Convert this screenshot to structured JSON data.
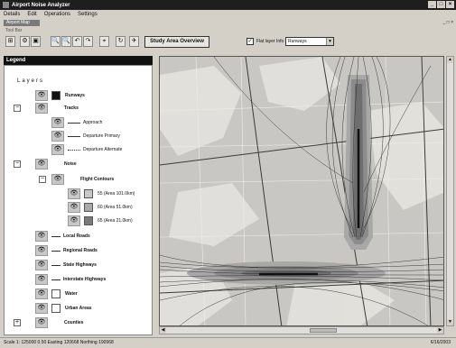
{
  "window": {
    "title": "Airport Noise Analyzer",
    "minimize": "_",
    "maximize": "□",
    "close": "×"
  },
  "menu": [
    "Details",
    "Edit",
    "Operations",
    "Settings"
  ],
  "doc_tab": {
    "label": "Airport Map",
    "controls": "_ □ ×"
  },
  "toolbar": {
    "caption": "Tool Bar",
    "buttons": [
      "⊞",
      "⚙",
      "▣",
      "🔍",
      "🔍",
      "↶",
      "↷",
      "⌖",
      "↻",
      "✈"
    ],
    "study_button": "Study Area Overview",
    "checkbox_checked": "✓",
    "checkbox_label": "Flat layer Info",
    "dropdown_value": "Runways",
    "dropdown_arrow": "▼"
  },
  "legend": {
    "header": "Legend",
    "layers_title": "Layers",
    "items": [
      {
        "label": "Runways",
        "bold": true,
        "swatch": "#111111"
      },
      {
        "label": "Tracks",
        "bold": true,
        "expander": "−"
      },
      {
        "label": "Approach"
      },
      {
        "label": "Departure Primary"
      },
      {
        "label": "Departure Alternate"
      },
      {
        "label": "Noise",
        "bold": true,
        "expander": "−"
      },
      {
        "label": "Flight Contours",
        "bold": true,
        "expander": "−"
      },
      {
        "label": "55 (Area 101.0km)",
        "swatch": "#c8c8c8"
      },
      {
        "label": "60 (Area 51.0km)",
        "swatch": "#aaaaaa"
      },
      {
        "label": "65 (Area 21.0km)",
        "swatch": "#7a7a7a"
      },
      {
        "label": "Local Roads"
      },
      {
        "label": "Regional Roads"
      },
      {
        "label": "State Highways"
      },
      {
        "label": "Interstate Highways"
      },
      {
        "label": "Water",
        "swatch": "#ffffff"
      },
      {
        "label": "Urban Areas",
        "swatch": "#ffffff"
      },
      {
        "label": "Counties",
        "bold": true,
        "expander": "+"
      }
    ],
    "eye_icon": "👁"
  },
  "map": {
    "background_color": "#c9c7c3",
    "contour_colors": [
      "#a8a8a8",
      "#8c8c8c",
      "#6e6e6e"
    ],
    "runway_color": "#111111",
    "scroll_up": "▲",
    "scroll_down": "▼",
    "scroll_left": "◀",
    "scroll_right": "▶"
  },
  "status": {
    "text": "Scale 1: 125000   0.50 Easting 120668   Northing 190968",
    "date": "6/16/2003"
  }
}
